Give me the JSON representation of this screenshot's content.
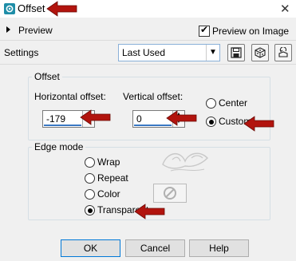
{
  "window": {
    "title": "Offset",
    "close_glyph": "✕"
  },
  "preview": {
    "label": "Preview",
    "preview_on_image_label": "Preview on Image",
    "preview_on_image_checked": true
  },
  "settings": {
    "label": "Settings",
    "preset_value": "Last Used",
    "icons": [
      "save-icon",
      "dice-icon",
      "reset-icon"
    ]
  },
  "offset_group": {
    "title": "Offset",
    "horizontal_label": "Horizontal offset:",
    "horizontal_value": "-179",
    "vertical_label": "Vertical offset:",
    "vertical_value": "0",
    "center_label": "Center",
    "custom_label": "Custom",
    "selected": "custom"
  },
  "edge_group": {
    "title": "Edge mode",
    "options": [
      "Wrap",
      "Repeat",
      "Color",
      "Transparent"
    ],
    "selected": "Transparent"
  },
  "buttons": {
    "ok": "OK",
    "cancel": "Cancel",
    "help": "Help"
  },
  "colors": {
    "annotation_arrow": "#b2140e",
    "focus_blue": "#3a78c4",
    "title_icon": "#1f8ea8"
  }
}
